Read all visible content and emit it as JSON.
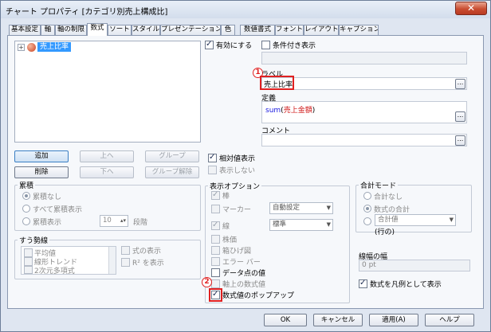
{
  "window": {
    "title": "チャート プロパティ [カテゴリ別売上構成比]",
    "close": "✕"
  },
  "tabs": [
    "基本設定",
    "軸",
    "軸の制限",
    "数式",
    "ソート",
    "スタイル",
    "プレゼンテーション",
    "色",
    "数値書式",
    "フォント",
    "レイアウト",
    "キャプション"
  ],
  "active_tab": "数式",
  "tree": {
    "expander": "+",
    "item": "売上比率"
  },
  "buttons": {
    "add": "追加",
    "delete": "削除",
    "up": "上へ",
    "down": "下へ",
    "group": "グループ",
    "ungroup": "グループ解除"
  },
  "accumulate": {
    "title": "累積",
    "options": [
      "累積なし",
      "すべて累積表示",
      "累積表示"
    ],
    "steps_value": "10",
    "steps_label": "段階"
  },
  "trendlines": {
    "title": "すう勢線",
    "items": [
      "平均値",
      "線形トレンド",
      "2次元多項式"
    ],
    "show_formula": "式の表示",
    "show_r2": "R² を表示"
  },
  "enable": {
    "label": "有効にする",
    "checked": true
  },
  "conditional": {
    "label": "条件付き表示",
    "checked": false
  },
  "label_field": {
    "title": "ラベル",
    "value": "売上比率",
    "ellipsis": "..."
  },
  "definition": {
    "title": "定義",
    "func": "sum",
    "paren_open": "(",
    "arg": "売上金額",
    "paren_close": ")",
    "ellipsis": "..."
  },
  "comment": {
    "title": "コメント",
    "value": "",
    "ellipsis": "..."
  },
  "relative": {
    "label": "相対値表示",
    "checked": true
  },
  "hide": {
    "label": "表示しない",
    "checked": false
  },
  "display_options": {
    "title": "表示オプション",
    "bar": "棒",
    "marker": "マーカー",
    "marker_combo": "自動設定",
    "line": "線",
    "line_combo": "標準",
    "candle": "株価",
    "box": "箱ひげ図",
    "error": "エラー バー",
    "data_values": "データ点の値",
    "axis_values": "軸上の数式値",
    "popup": "数式値のポップアップ"
  },
  "total_mode": {
    "title": "合計モード",
    "none": "合計なし",
    "sum_of": "数式の合計",
    "combo": "合計値",
    "rows": "(行の)"
  },
  "line_width": {
    "title": "線幅の幅",
    "value": "0 pt"
  },
  "legend": {
    "label": "数式を凡例として表示",
    "checked": true
  },
  "annotations": {
    "one": "1",
    "two": "2"
  },
  "footer": {
    "ok": "OK",
    "cancel": "キャンセル",
    "apply": "適用(A)",
    "help": "ヘルプ"
  },
  "colors": {
    "accent_red": "#e02020",
    "selected_blue": "#3399ff",
    "func_blue": "#1a1ae0",
    "arg_red": "#d01818"
  }
}
